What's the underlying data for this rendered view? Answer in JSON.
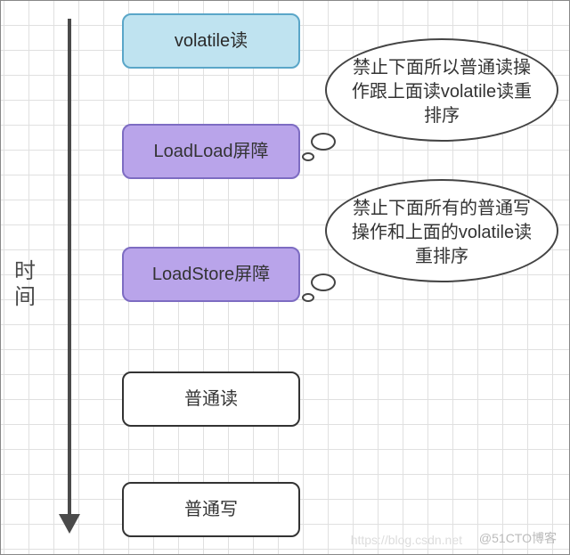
{
  "timeAxis": {
    "label": "时\n间"
  },
  "nodes": {
    "volatileRead": {
      "label": "volatile读"
    },
    "loadLoad": {
      "label": "LoadLoad屏障"
    },
    "loadStore": {
      "label": "LoadStore屏障"
    },
    "normalRead": {
      "label": "普通读"
    },
    "normalWrite": {
      "label": "普通写"
    }
  },
  "bubbles": {
    "b1": {
      "text": "禁止下面所以普通读操作跟上面读volatile读重排序"
    },
    "b2": {
      "text": "禁止下面所有的普通写操作和上面的volatile读重排序"
    }
  },
  "watermark": {
    "right": "@51CTO博客",
    "left": "https://blog.csdn.net"
  }
}
